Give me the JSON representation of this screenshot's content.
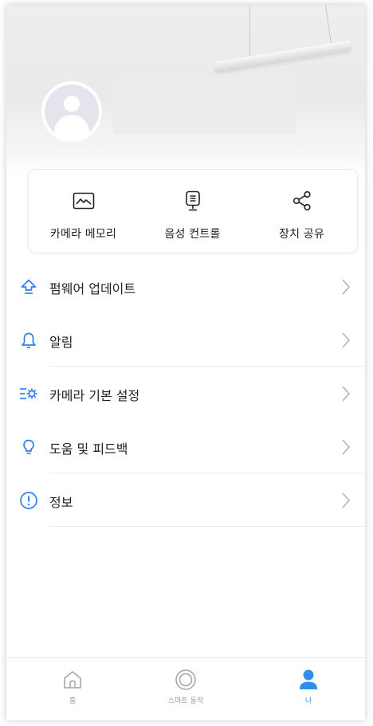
{
  "colors": {
    "accent": "#2b8ef0",
    "icon_blue": "#2f7ef5",
    "text": "#222222",
    "muted": "#9a9a9e",
    "chevron": "#b0b0b4"
  },
  "profile": {
    "avatar_icon": "user-avatar-icon"
  },
  "quick_actions": [
    {
      "icon": "photo-frame-icon",
      "label": "카메라 메모리"
    },
    {
      "icon": "voice-remote-icon",
      "label": "음성 컨트롤"
    },
    {
      "icon": "share-icon",
      "label": "장치 공유"
    }
  ],
  "menu": [
    {
      "icon": "upload-arrow-icon",
      "label": "펌웨어 업데이트"
    },
    {
      "icon": "bell-icon",
      "label": "알림"
    },
    {
      "icon": "settings-sliders-icon",
      "label": "카메라 기본 설정"
    },
    {
      "icon": "lightbulb-icon",
      "label": "도움 및 피드백"
    },
    {
      "icon": "info-icon",
      "label": "정보"
    }
  ],
  "tabbar": {
    "tabs": [
      {
        "icon": "home-icon",
        "label": "홈",
        "active": false
      },
      {
        "icon": "circle-target-icon",
        "label": "스마트 동작",
        "active": false
      },
      {
        "icon": "person-icon",
        "label": "나",
        "active": true
      }
    ]
  }
}
